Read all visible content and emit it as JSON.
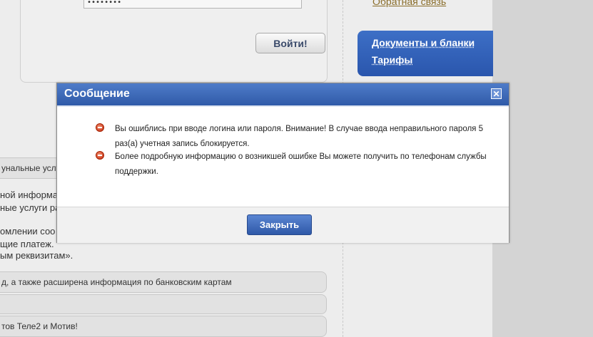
{
  "login": {
    "password_value": "••••••••",
    "submit_label": "Войти!"
  },
  "sidebar": {
    "feedback_link": "Обратная связь",
    "documents_link": "Документы и бланки",
    "tariffs_link": "Тарифы"
  },
  "content": {
    "row_1": "унальные услу",
    "para_1_line_1": "ной  информа",
    "para_1_line_2": "ные услуги ра",
    "para_2_line_1": "омлении соо",
    "para_2_line_2": "щие платеж.",
    "para_2_line_3": "ым реквизитам».",
    "row_2": "д, а также расширена информация по банковским картам",
    "row_3": "",
    "row_4": "тов Теле2 и Мотив!"
  },
  "dialog": {
    "title": "Сообщение",
    "messages": [
      "Вы ошиблись при вводе логина или пароля. Внимание! В случае ввода неправильного пароля 5 раз(а) учетная запись блокируется.",
      "Более подробную информацию о возникшей ошибке Вы можете получить по телефонам службы поддержки."
    ],
    "close_button": "Закрыть",
    "close_icon_glyph": "✕"
  },
  "colors": {
    "dialog_header": "#3a66b8",
    "primary_button": "#3b63b0",
    "error_icon": "#d23a1a"
  }
}
